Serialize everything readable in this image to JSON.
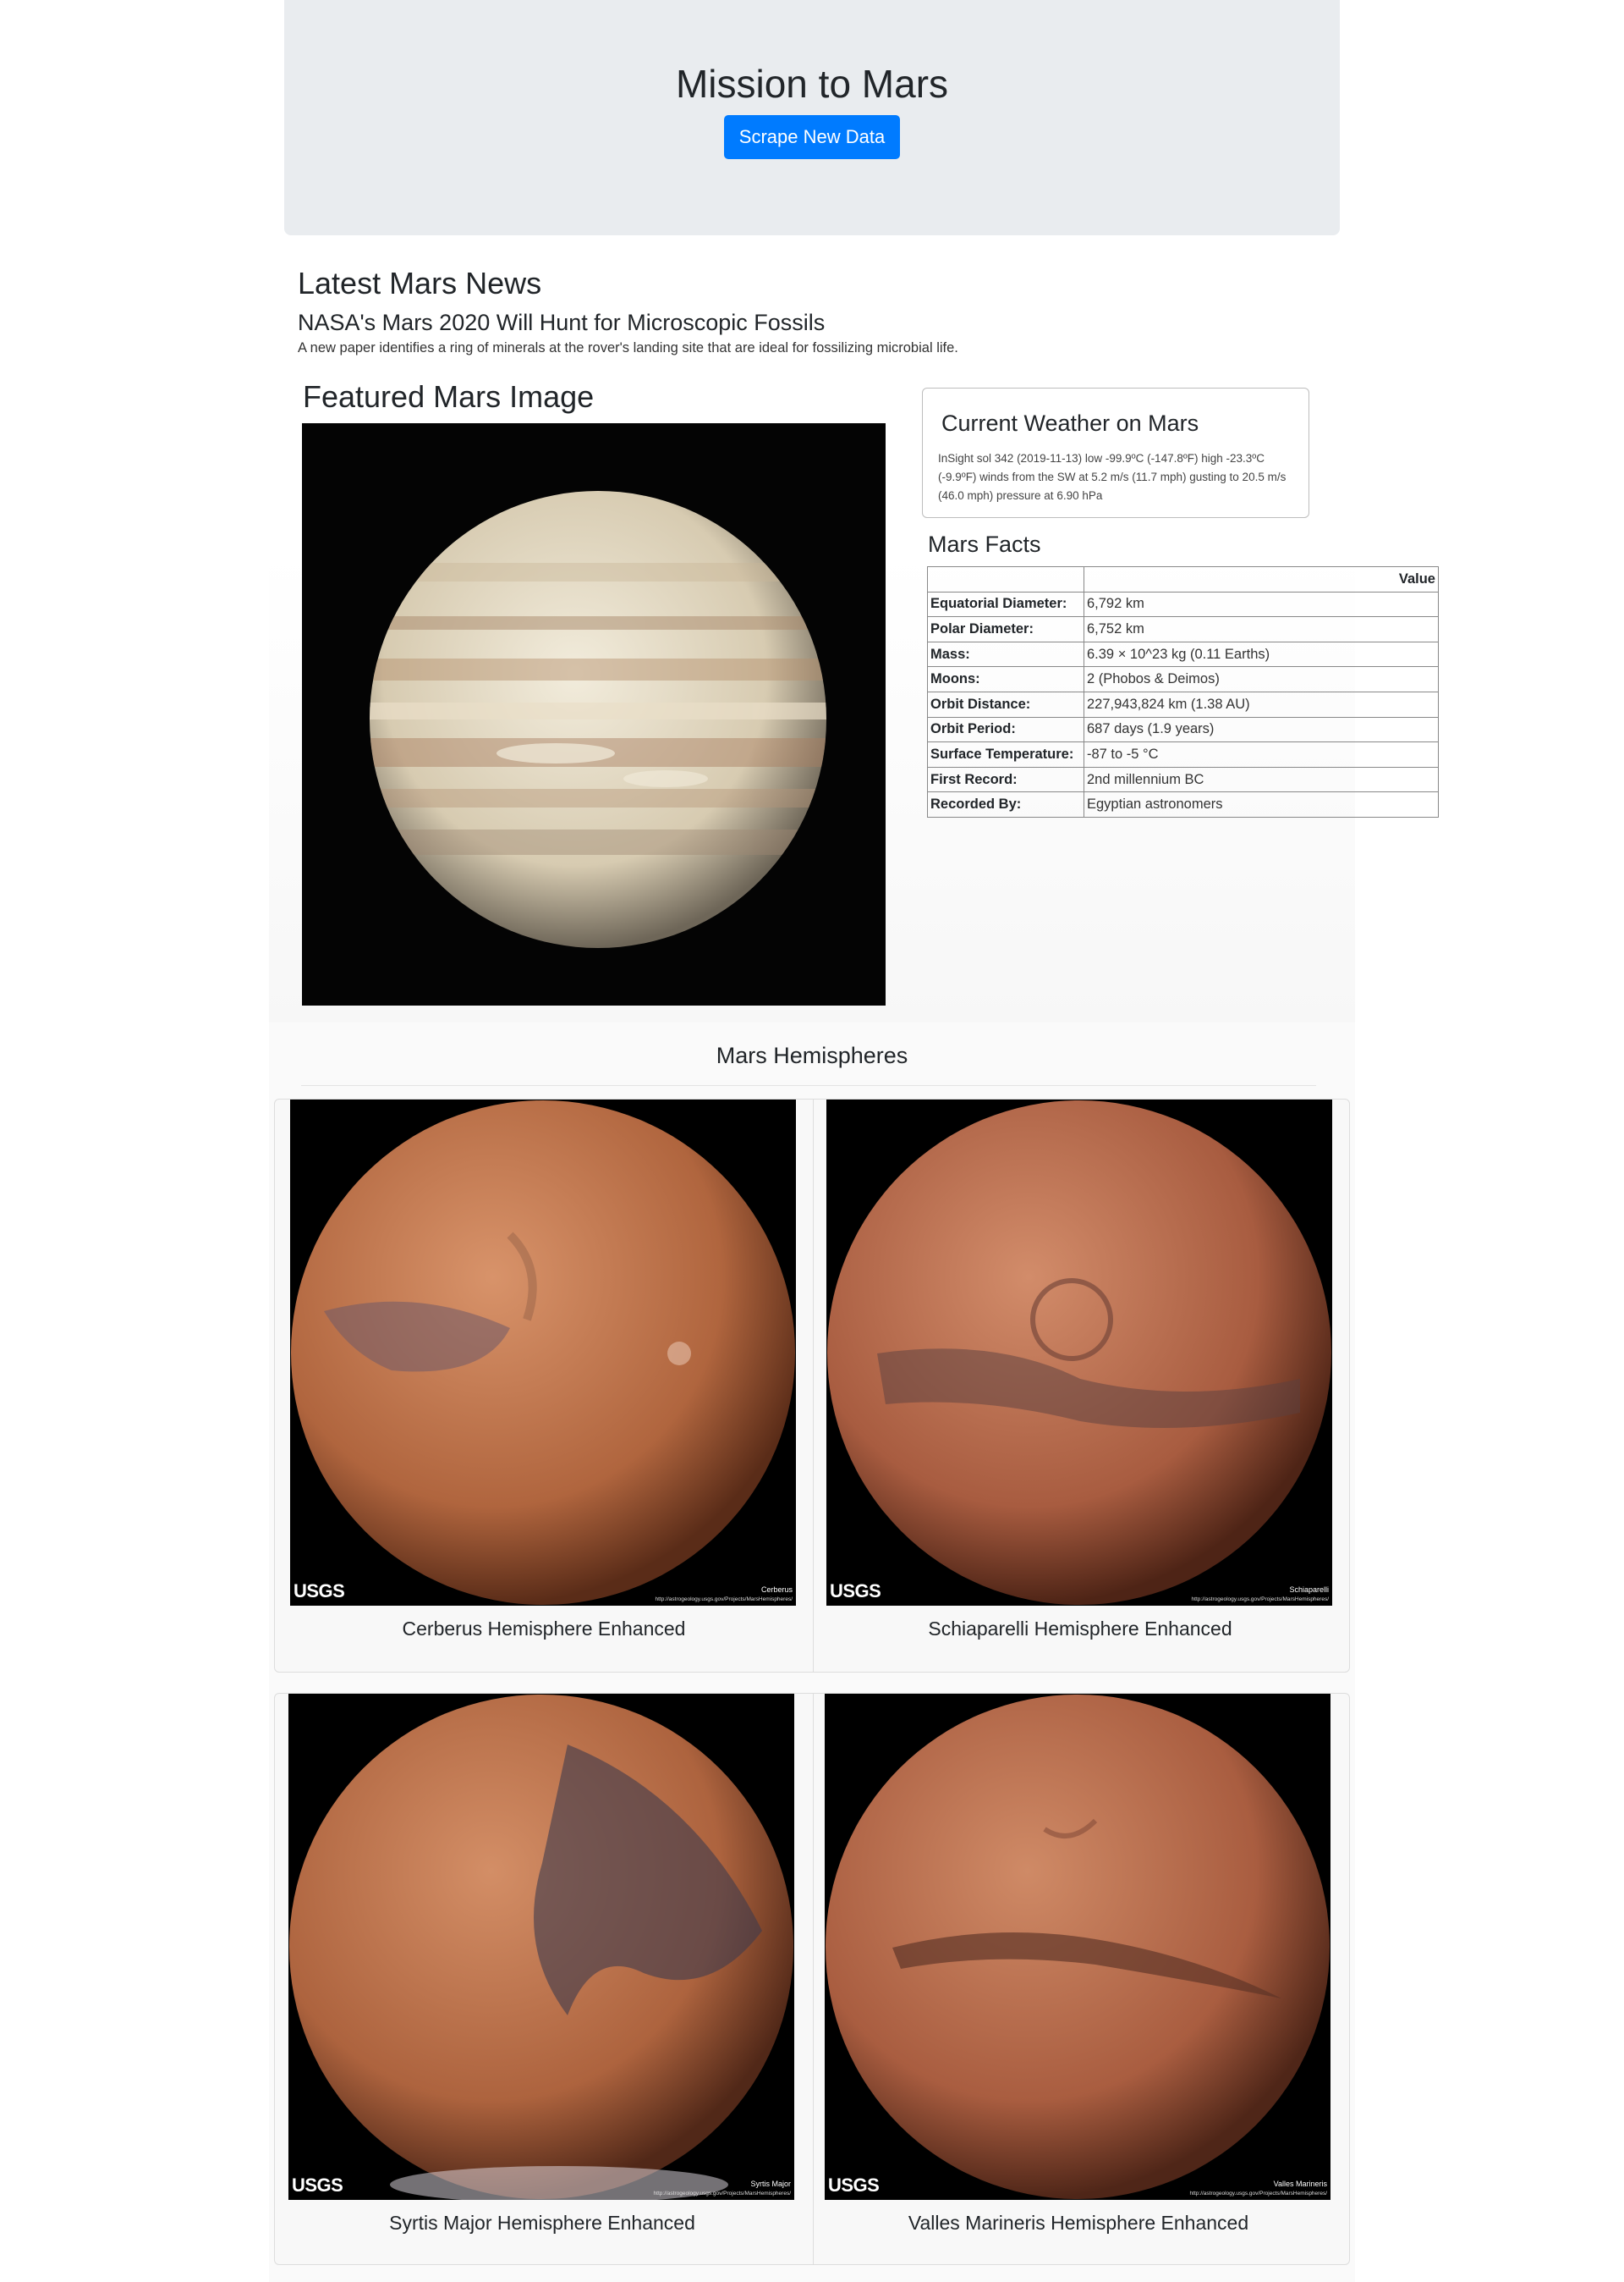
{
  "header": {
    "title": "Mission to Mars",
    "scrape_button": "Scrape New Data"
  },
  "news": {
    "section_title": "Latest Mars News",
    "headline": "NASA's Mars 2020 Will Hunt for Microscopic Fossils",
    "teaser": "A new paper identifies a ring of minerals at the rover's landing site that are ideal for fossilizing microbial life."
  },
  "featured": {
    "section_title": "Featured Mars Image",
    "image_icon": "planet-image"
  },
  "weather": {
    "title": "Current Weather on Mars",
    "text": "InSight sol 342 (2019-11-13) low -99.9ºC (-147.8ºF) high -23.3ºC (-9.9ºF) winds from the SW at 5.2 m/s (11.7 mph) gusting to 20.5 m/s (46.0 mph) pressure at 6.90 hPa"
  },
  "facts": {
    "title": "Mars Facts",
    "value_header": "Value",
    "rows": [
      {
        "label": "Equatorial Diameter:",
        "value": "6,792 km"
      },
      {
        "label": "Polar Diameter:",
        "value": "6,752 km"
      },
      {
        "label": "Mass:",
        "value": "6.39 × 10^23 kg (0.11 Earths)"
      },
      {
        "label": "Moons:",
        "value": "2 (Phobos & Deimos)"
      },
      {
        "label": "Orbit Distance:",
        "value": "227,943,824 km (1.38 AU)"
      },
      {
        "label": "Orbit Period:",
        "value": "687 days (1.9 years)"
      },
      {
        "label": "Surface Temperature:",
        "value": "-87 to -5 °C"
      },
      {
        "label": "First Record:",
        "value": "2nd millennium BC"
      },
      {
        "label": "Recorded By:",
        "value": "Egyptian astronomers"
      }
    ]
  },
  "hemispheres": {
    "section_title": "Mars Hemispheres",
    "usgs_logo": "USGS",
    "url": "http://astrogeology.usgs.gov/Projects/MarsHemispheres/",
    "items": [
      {
        "title": "Cerberus Hemisphere Enhanced",
        "image_label": "Cerberus",
        "color": "#c0704a"
      },
      {
        "title": "Schiaparelli Hemisphere Enhanced",
        "image_label": "Schiaparelli",
        "color": "#b8684a"
      },
      {
        "title": "Syrtis Major Hemisphere Enhanced",
        "image_label": "Syrtis Major",
        "color": "#b56a48"
      },
      {
        "title": "Valles Marineris Hemisphere Enhanced",
        "image_label": "Valles Marineris",
        "color": "#b8664a"
      }
    ]
  },
  "colors": {
    "jumbotron_bg": "#e9ecef",
    "button_primary": "#007bff"
  }
}
